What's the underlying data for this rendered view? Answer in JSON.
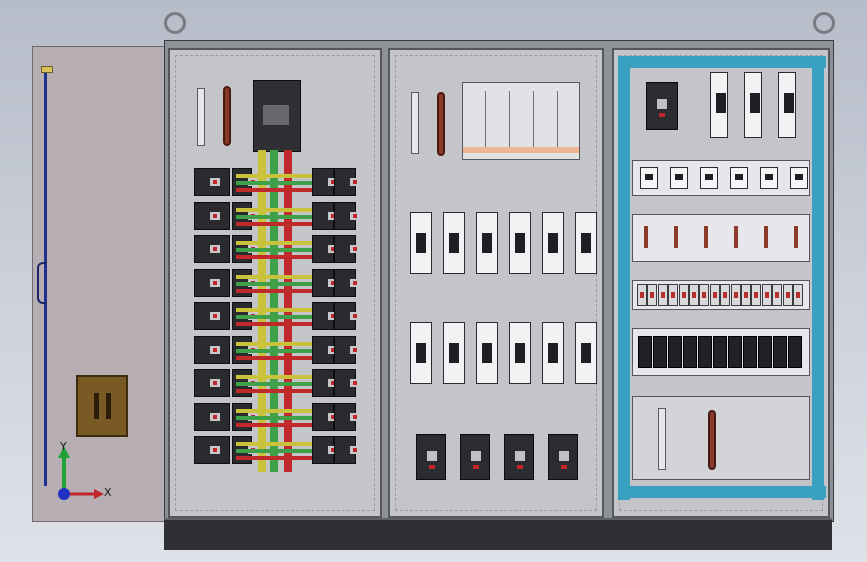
{
  "axes": {
    "x_label": "X",
    "y_label": "Y"
  },
  "colors": {
    "phase_yellow": "#c9c23a",
    "phase_green": "#3fa04a",
    "phase_red": "#c02a2a",
    "teal_frame": "#3aa0bf",
    "door": "#b7aeb4",
    "copper": "#8a3a2a"
  },
  "icons": [
    "lifting-eye-icon",
    "axis-triad-icon",
    "circuit-breaker-icon",
    "contactor-icon",
    "copper-busbar-icon"
  ]
}
